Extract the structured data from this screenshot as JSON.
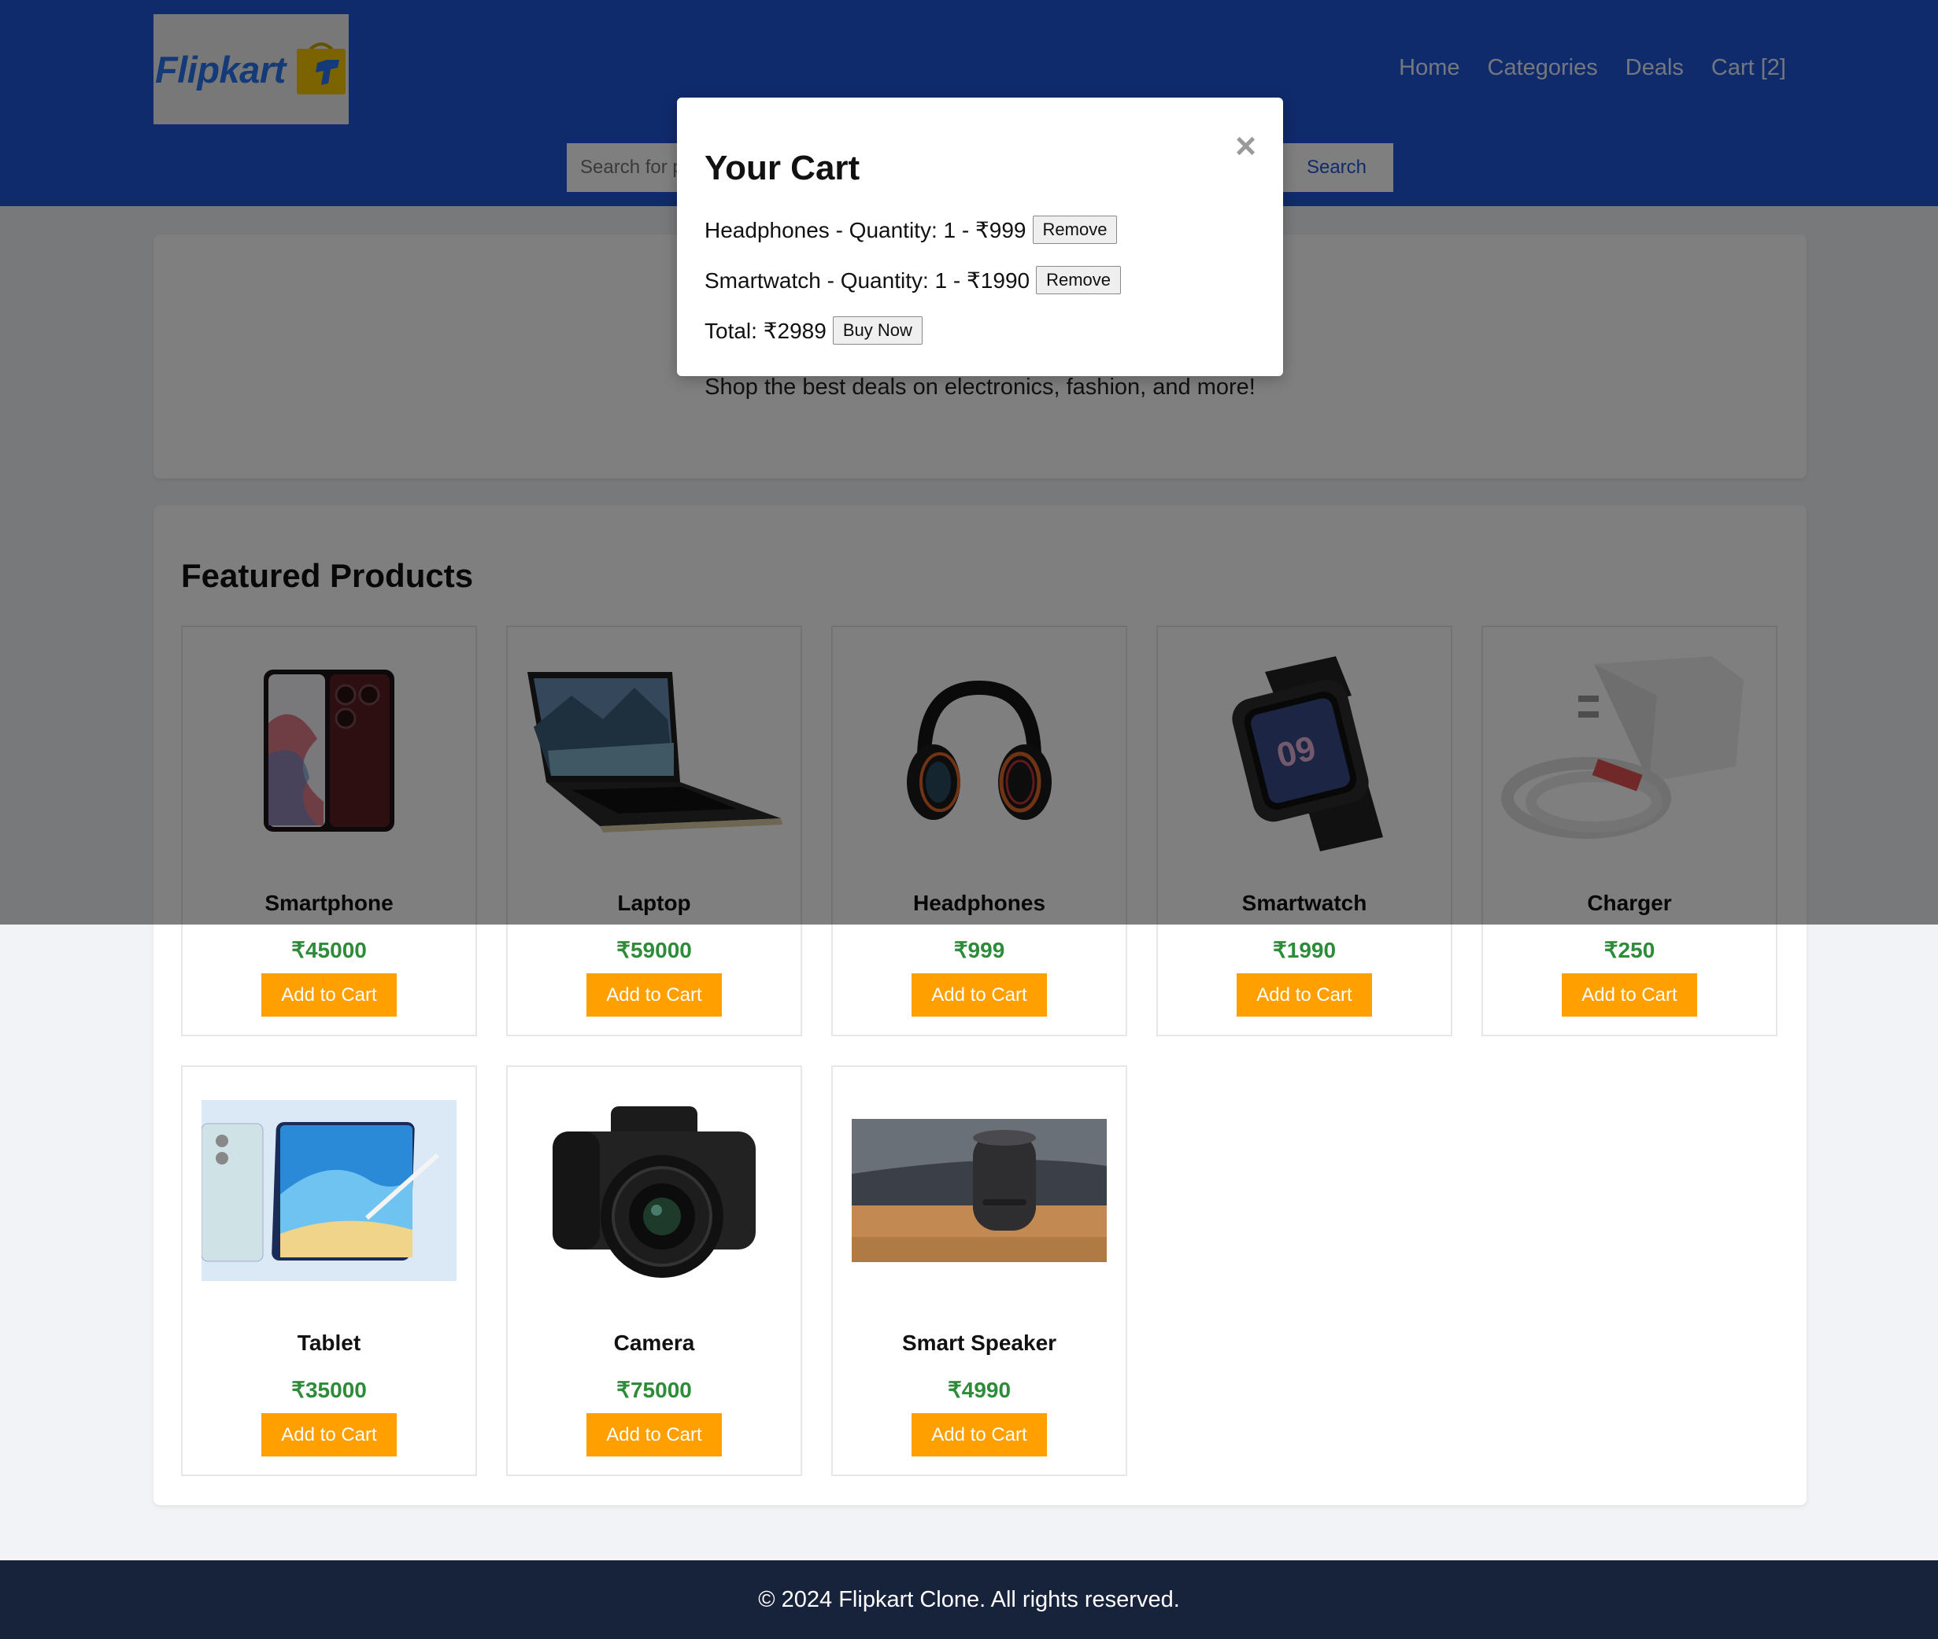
{
  "header": {
    "logo_text": "Flipkart",
    "nav": [
      "Home",
      "Categories",
      "Deals",
      "Cart [2]"
    ],
    "search_placeholder": "Search for products",
    "search_button": "Search"
  },
  "hero": {
    "subtitle": "Shop the best deals on electronics, fashion, and more!"
  },
  "products": {
    "title": "Featured Products",
    "add_label": "Add to Cart",
    "items": [
      {
        "name": "Smartphone",
        "price": "₹45000",
        "icon": "smartphone-image"
      },
      {
        "name": "Laptop",
        "price": "₹59000",
        "icon": "laptop-image"
      },
      {
        "name": "Headphones",
        "price": "₹999",
        "icon": "headphones-image"
      },
      {
        "name": "Smartwatch",
        "price": "₹1990",
        "icon": "smartwatch-image"
      },
      {
        "name": "Charger",
        "price": "₹250",
        "icon": "charger-image"
      },
      {
        "name": "Tablet",
        "price": "₹35000",
        "icon": "tablet-image"
      },
      {
        "name": "Camera",
        "price": "₹75000",
        "icon": "camera-image"
      },
      {
        "name": "Smart Speaker",
        "price": "₹4990",
        "icon": "smart-speaker-image"
      }
    ]
  },
  "cart_modal": {
    "title": "Your Cart",
    "close_icon": "×",
    "items": [
      {
        "text": "Headphones - Quantity: 1 - ₹999",
        "remove_label": "Remove"
      },
      {
        "text": "Smartwatch - Quantity: 1 - ₹1990",
        "remove_label": "Remove"
      }
    ],
    "total": "Total: ₹2989",
    "buy_label": "Buy Now"
  },
  "footer": {
    "text": "© 2024 Flipkart Clone. All rights reserved."
  },
  "colors": {
    "header": "#2157d6",
    "accent_button": "#ff9f00",
    "price": "#2e8b3a",
    "footer": "#17223b"
  }
}
